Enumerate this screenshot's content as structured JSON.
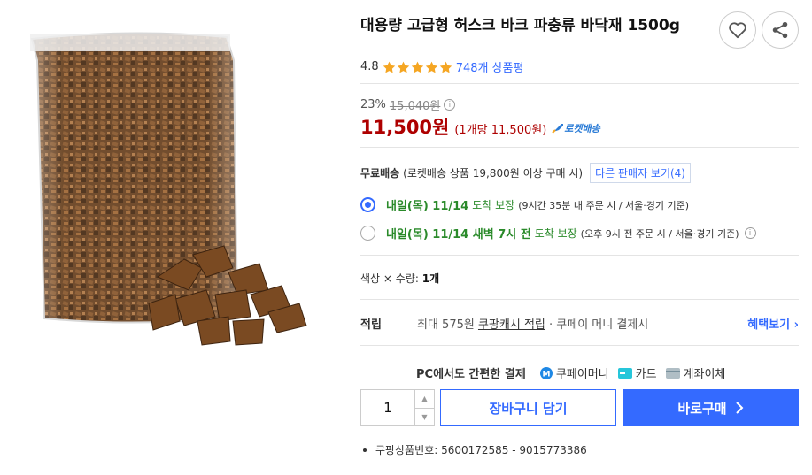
{
  "product": {
    "title": "대용량 고급형 허스크 바크 파충류 바닥재 1500g",
    "rating": "4.8",
    "stars": 5,
    "review_count": "748개 상품평"
  },
  "price": {
    "discount_pct": "23%",
    "original_price": "15,040원",
    "sale_price": "11,500원",
    "unit_price": "(1개당 11,500원)",
    "rocket_label": "로켓배송"
  },
  "shipping": {
    "free_label": "무료배송",
    "free_desc": "(로켓배송 상품 19,800원 이상 구매 시)",
    "other_sellers": "다른 판매자 보기(4)",
    "options": [
      {
        "date": "내일(목) 11/14",
        "guarantee": "도착 보장",
        "cond": "(9시간 35분 내 주문 시 / 서울·경기 기준)",
        "selected": true
      },
      {
        "date": "내일(목) 11/14 새벽 7시 전",
        "guarantee": "도착 보장",
        "cond": "(오후 9시 전 주문 시 / 서울·경기 기준)",
        "selected": false
      }
    ]
  },
  "option_summary": {
    "prefix": "색상 × 수량:",
    "value": "1개"
  },
  "points": {
    "label": "적립",
    "prefix": "최대 575원",
    "cash_link": "쿠팡캐시 적립",
    "suffix": "· 쿠페이 머니 결제시",
    "benefit_link": "혜택보기"
  },
  "payment": {
    "label": "PC에서도 간편한 결제",
    "methods": [
      "쿠페이머니",
      "카드",
      "계좌이체"
    ]
  },
  "purchase": {
    "quantity": "1",
    "cart_label": "장바구니 담기",
    "buy_label": "바로구매"
  },
  "product_number": "쿠팡상품번호: 5600172585 - 9015773386",
  "colors": {
    "accent": "#346aff",
    "price_red": "#ae0000",
    "delivery_green": "#2a8a2a"
  }
}
